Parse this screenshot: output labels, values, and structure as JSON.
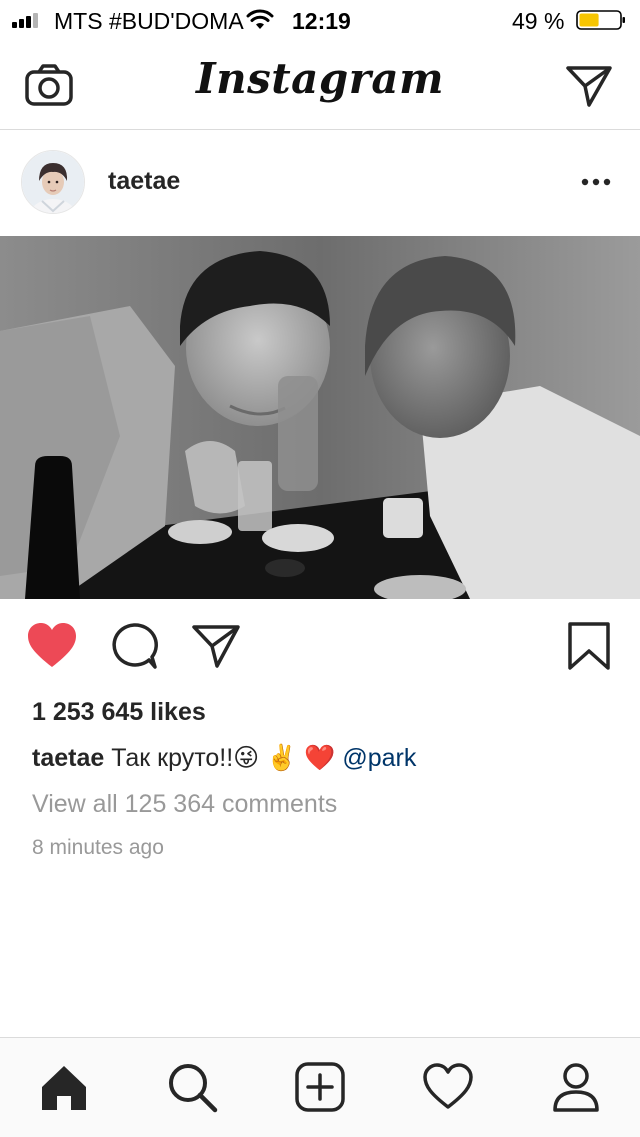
{
  "status_bar": {
    "carrier": "MTS #BUD'DOMA",
    "time": "12:19",
    "battery_percent": "49 %",
    "battery_level": 0.49,
    "battery_color": "#f7c500",
    "icons": [
      "signal-icon",
      "wifi-icon",
      "battery-icon"
    ]
  },
  "header": {
    "logo": "Instagram",
    "left_icon": "camera-icon",
    "right_icon": "direct-message-icon"
  },
  "post": {
    "username": "taetae",
    "more_icon": "more-icon",
    "image": "black-and-white selfie photo",
    "liked": true,
    "like_color": "#ed4956",
    "likes": "1 253 645 likes",
    "caption": {
      "username": "taetae",
      "text": "Так круто!!😜 ✌️ ❤️",
      "mention": "@park"
    },
    "view_comments": "View all 125 364 comments",
    "timestamp": "8 minutes ago"
  },
  "tab_bar": {
    "items": [
      "home-icon",
      "search-icon",
      "new-post-icon",
      "activity-icon",
      "profile-icon"
    ]
  }
}
